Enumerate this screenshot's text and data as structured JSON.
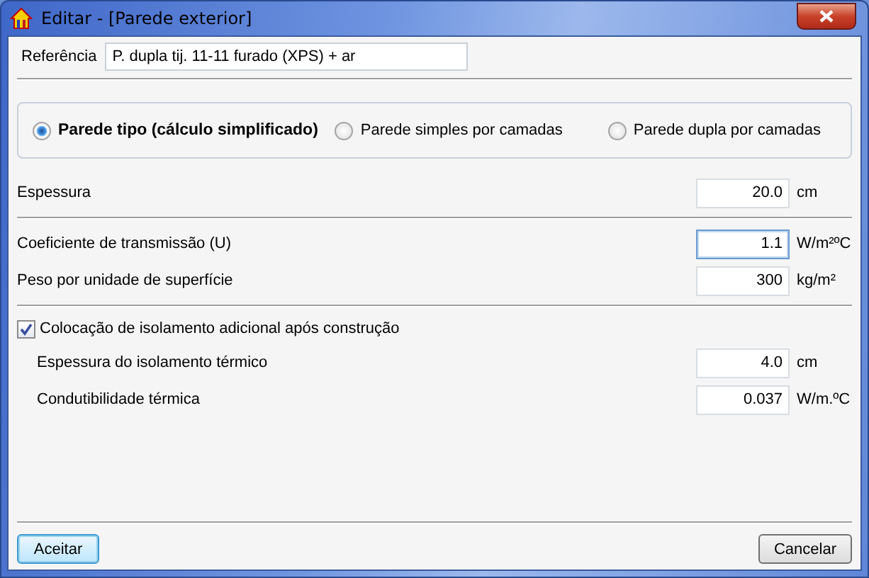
{
  "window": {
    "title": "Editar - [Parede exterior]"
  },
  "reference": {
    "label": "Referência",
    "value": "P. dupla tij. 11-11 furado (XPS) + ar"
  },
  "wall_types": [
    {
      "label": "Parede tipo (cálculo simplificado)",
      "selected": true
    },
    {
      "label": "Parede simples por camadas",
      "selected": false
    },
    {
      "label": "Parede dupla por camadas",
      "selected": false
    }
  ],
  "thickness": {
    "label": "Espessura",
    "value": "20.0",
    "unit": "cm",
    "focused": false
  },
  "properties": [
    {
      "label": "Coeficiente de transmissão (U)",
      "value": "1.1",
      "unit": "W/m²ºC",
      "focused": true
    },
    {
      "label": "Peso por unidade de superfície",
      "value": "300",
      "unit": "kg/m²",
      "focused": false
    }
  ],
  "insulation": {
    "label": "Colocação de isolamento adicional após construção",
    "checked": true,
    "fields": [
      {
        "label": "Espessura do isolamento térmico",
        "value": "4.0",
        "unit": "cm",
        "focused": false
      },
      {
        "label": "Condutibilidade térmica",
        "value": "0.037",
        "unit": "W/m.ºC",
        "focused": false
      }
    ]
  },
  "buttons": [
    {
      "label": "Aceitar",
      "default": true
    },
    {
      "label": "Cancelar",
      "default": false
    }
  ]
}
